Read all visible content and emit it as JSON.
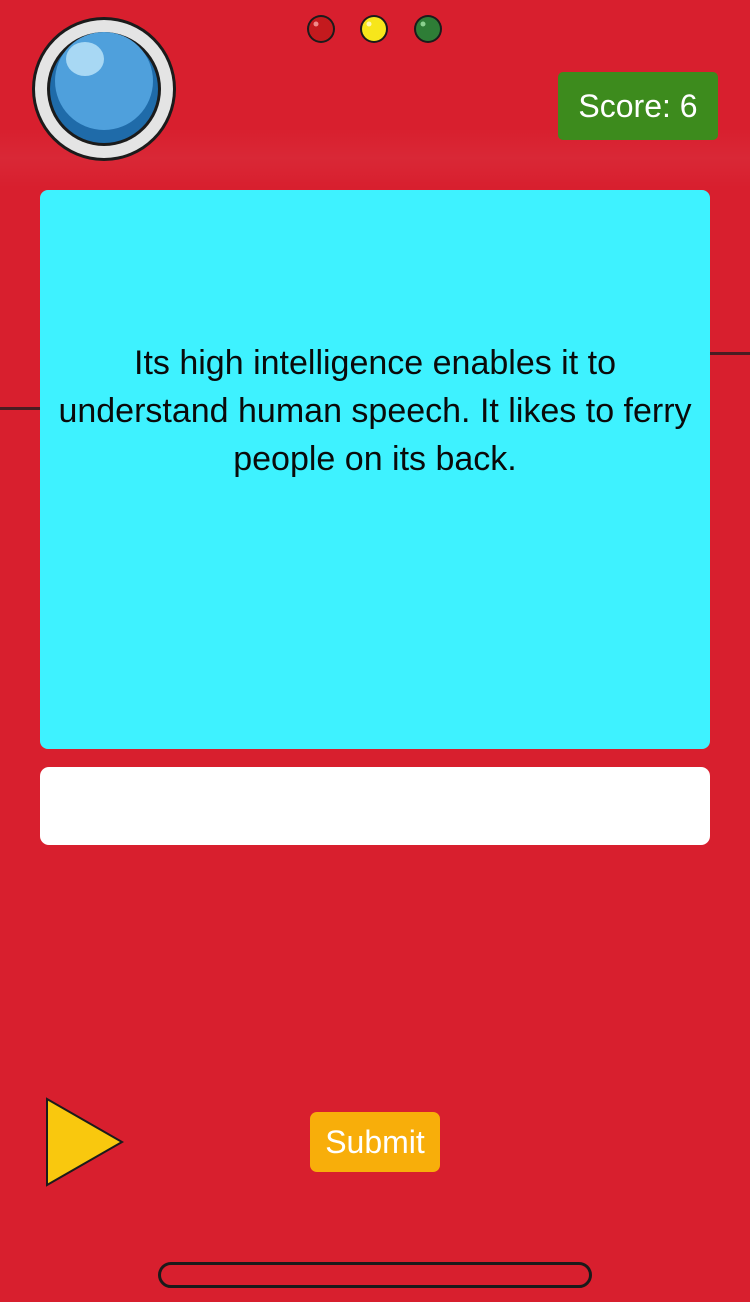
{
  "device": {
    "body_color": "#d81f2e",
    "lens": {
      "icon": "blue-lens-icon",
      "color": "#2f86c8"
    },
    "indicators": [
      {
        "icon": "red-light-icon",
        "color": "#c41a1e"
      },
      {
        "icon": "yellow-light-icon",
        "color": "#f7e61b"
      },
      {
        "icon": "green-light-icon",
        "color": "#2e7d36"
      }
    ]
  },
  "score": {
    "label": "Score: 6",
    "value": 6,
    "color": "#3d8b1d"
  },
  "screen": {
    "clue": "Its high intelligence enables it to understand human speech. It likes to ferry people on its back.",
    "color": "#3ef2ff"
  },
  "answer": {
    "value": "",
    "placeholder": ""
  },
  "controls": {
    "play_icon": "play-triangle-icon",
    "play_color": "#f9c80e",
    "submit_label": "Submit",
    "submit_color": "#f8ae0a"
  }
}
